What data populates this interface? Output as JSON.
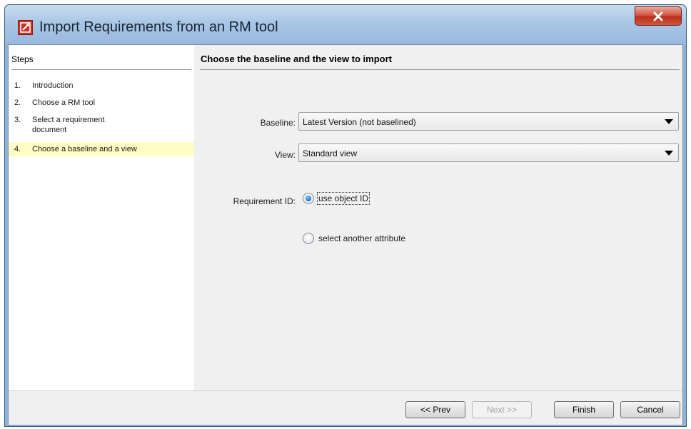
{
  "window": {
    "title": "Import Requirements from an RM tool",
    "close_label": "X"
  },
  "steps": {
    "header": "Steps",
    "items": [
      {
        "num": "1.",
        "label": "Introduction",
        "active": false
      },
      {
        "num": "2.",
        "label": "Choose a RM tool",
        "active": false
      },
      {
        "num": "3.",
        "label": "Select a requirement document",
        "active": false
      },
      {
        "num": "4.",
        "label": "Choose a baseline and a view",
        "active": true
      }
    ],
    "active_highlight_color": "#fffcc6"
  },
  "main": {
    "header": "Choose the baseline and the view to import",
    "baseline": {
      "label": "Baseline:",
      "value": "Latest Version (not baselined)"
    },
    "view": {
      "label": "View:",
      "value": "Standard view"
    },
    "requirement_id": {
      "label": "Requirement ID:",
      "options": [
        {
          "label": "use object ID",
          "selected": true
        },
        {
          "label": "select another attribute",
          "selected": false
        }
      ]
    }
  },
  "buttons": {
    "prev": "<< Prev",
    "next": "Next >>",
    "finish": "Finish",
    "cancel": "Cancel"
  },
  "colors": {
    "title_bar": "#a9c6e6",
    "close_button": "#c7412a",
    "title_icon": "#d22f25",
    "radio_selected": "#1e7ed0"
  },
  "icons": {
    "title_icon": "app-logo-icon",
    "close_icon": "close-icon",
    "combo_arrow": "chevron-down-icon"
  }
}
